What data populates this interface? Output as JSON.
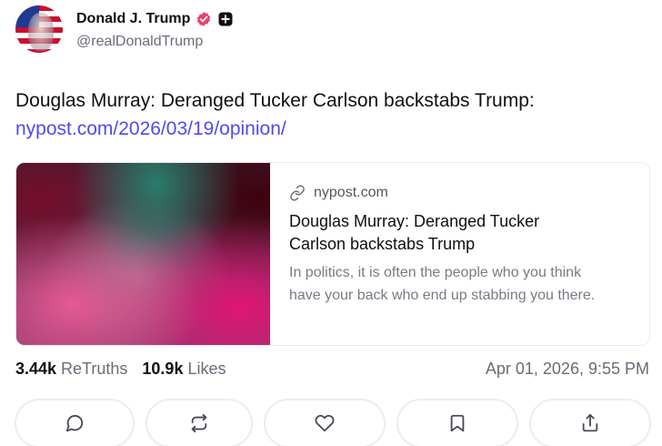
{
  "author": {
    "display_name": "Donald J. Trump",
    "handle": "@realDonaldTrump",
    "verified_badge_color": "#e7416a",
    "avatar_icon": "avatar-flag-portrait"
  },
  "post": {
    "text": "Douglas Murray: Deranged Tucker Carlson backstabs Trump:",
    "link_text": "nypost.com/2026/03/19/opinion/",
    "link_color": "#5448ee"
  },
  "link_card": {
    "domain": "nypost.com",
    "title": "Douglas Murray: Deranged Tucker Carlson backstabs Trump",
    "description": "In politics, it is often the people who you think have your back who end up stabbing you there.",
    "icon": "link-icon"
  },
  "stats": {
    "retruths_count": "3.44k",
    "retruths_label": "ReTruths",
    "likes_count": "10.9k",
    "likes_label": "Likes",
    "timestamp": "Apr 01, 2026, 9:55 PM"
  },
  "actions": [
    {
      "name": "reply",
      "icon": "comment-icon"
    },
    {
      "name": "retruth",
      "icon": "repost-icon"
    },
    {
      "name": "like",
      "icon": "heart-icon"
    },
    {
      "name": "bookmark",
      "icon": "bookmark-icon"
    },
    {
      "name": "share",
      "icon": "share-icon"
    }
  ]
}
